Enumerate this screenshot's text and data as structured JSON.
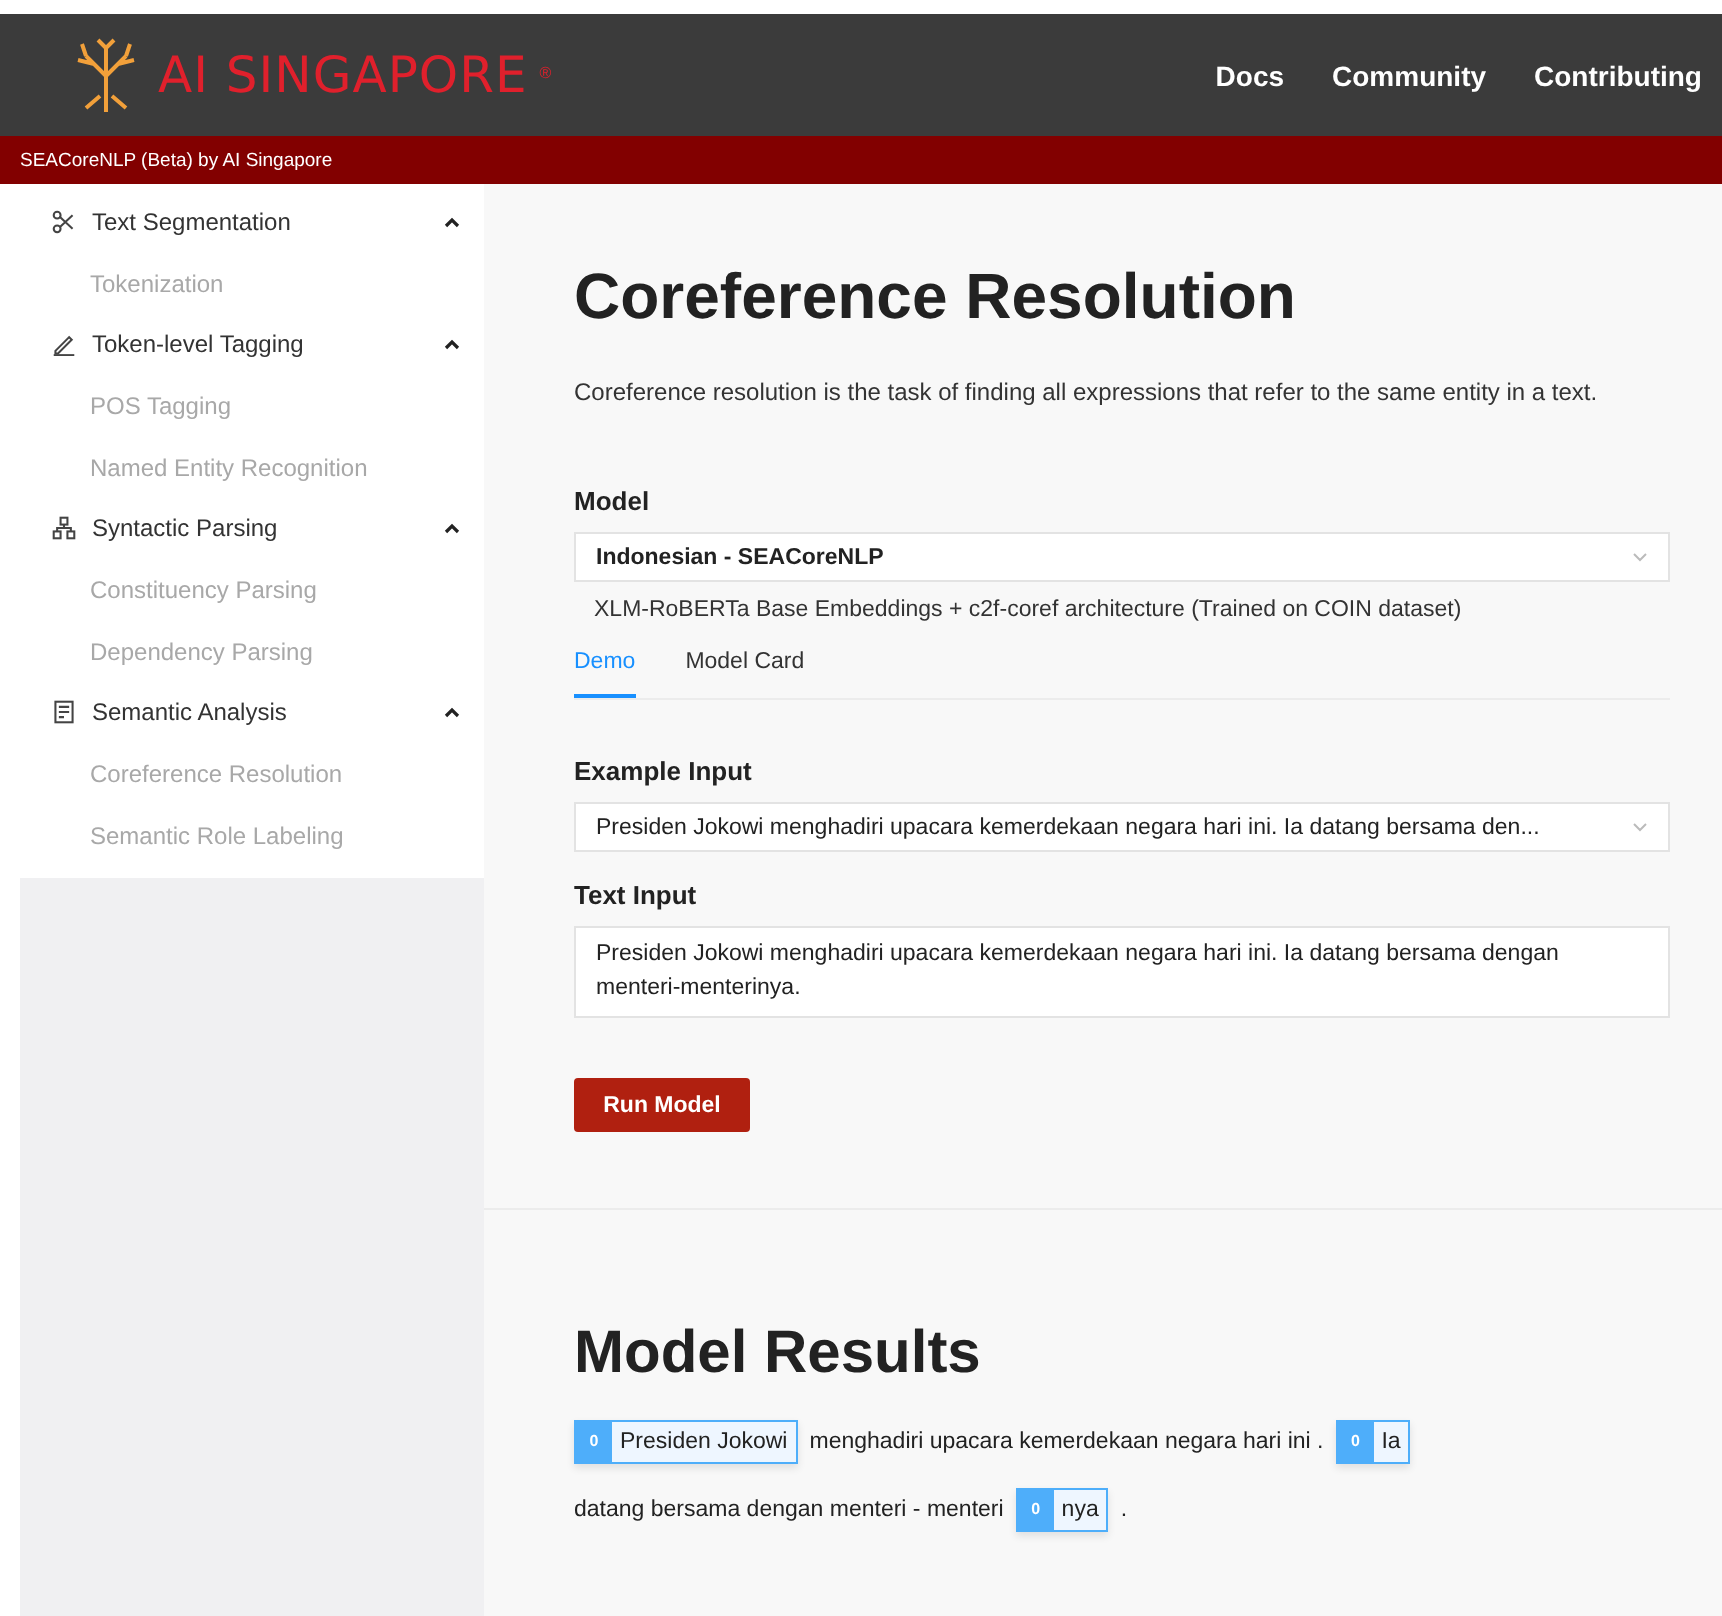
{
  "header": {
    "logo_text": "AI SINGAPORE",
    "logo_mark": "®",
    "nav": [
      "Docs",
      "Community",
      "Contributing"
    ]
  },
  "subbar": {
    "title": "SEACoreNLP (Beta) by AI Singapore"
  },
  "sidebar": {
    "groups": [
      {
        "label": "Text Segmentation",
        "expanded": true,
        "children": [
          {
            "label": "Tokenization"
          }
        ]
      },
      {
        "label": "Token-level Tagging",
        "expanded": true,
        "children": [
          {
            "label": "POS Tagging"
          },
          {
            "label": "Named Entity Recognition"
          }
        ]
      },
      {
        "label": "Syntactic Parsing",
        "expanded": true,
        "children": [
          {
            "label": "Constituency Parsing"
          },
          {
            "label": "Dependency Parsing"
          }
        ]
      },
      {
        "label": "Semantic Analysis",
        "expanded": true,
        "children": [
          {
            "label": "Coreference Resolution"
          },
          {
            "label": "Semantic Role Labeling"
          }
        ]
      }
    ]
  },
  "main": {
    "title": "Coreference Resolution",
    "description": "Coreference resolution is the task of finding all expressions that refer to the same entity in a text.",
    "model": {
      "label": "Model",
      "value": "Indonesian - SEACoreNLP",
      "note": "XLM-RoBERTa Base Embeddings + c2f-coref architecture (Trained on COIN dataset)"
    },
    "tabs": [
      {
        "label": "Demo",
        "selected": true
      },
      {
        "label": "Model Card",
        "selected": false
      }
    ],
    "example_input": {
      "label": "Example Input",
      "value": "Presiden Jokowi menghadiri upacara kemerdekaan negara hari ini. Ia datang bersama den..."
    },
    "text_input": {
      "label": "Text Input",
      "value": "Presiden Jokowi menghadiri upacara kemerdekaan negara hari ini. Ia datang bersama dengan menteri-menterinya."
    },
    "run_button": "Run Model"
  },
  "results": {
    "title": "Model Results",
    "segments": [
      {
        "kind": "mention",
        "cluster": "0",
        "text": "Presiden Jokowi"
      },
      {
        "kind": "text",
        "text": "menghadiri upacara kemerdekaan negara hari ini ."
      },
      {
        "kind": "mention",
        "cluster": "0",
        "text": "Ia"
      },
      {
        "kind": "text",
        "text": "datang bersama dengan menteri - menteri"
      },
      {
        "kind": "mention",
        "cluster": "0",
        "text": "nya"
      },
      {
        "kind": "text",
        "text": "."
      }
    ]
  }
}
